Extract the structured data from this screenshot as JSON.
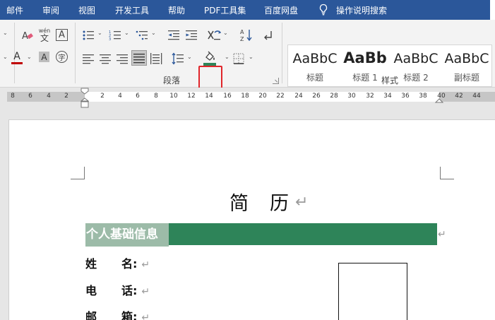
{
  "menu": {
    "tabs": [
      "邮件",
      "审阅",
      "视图",
      "开发工具",
      "帮助",
      "PDF工具集",
      "百度网盘",
      "操作说明搜索"
    ]
  },
  "ribbon": {
    "paragraph_label": "段落",
    "styles_label": "样式",
    "phonetic_glyph": "wén",
    "phonetic_base": "文",
    "box_char_glyph": "A",
    "shading_letter": "A",
    "enclose_char": "字",
    "font_color_letter": "A",
    "styles": [
      {
        "sample": "AaBbC",
        "name": "标题"
      },
      {
        "sample": "AaBb",
        "name": "标题 1"
      },
      {
        "sample": "AaBbC",
        "name": "标题 2"
      },
      {
        "sample": "AaBbC",
        "name": "副标题"
      }
    ]
  },
  "ruler": {
    "left_numbers": [
      "8",
      "6",
      "4",
      "2"
    ],
    "right_numbers": [
      "2",
      "4",
      "6",
      "8",
      "10",
      "12",
      "14",
      "16",
      "18",
      "20",
      "22",
      "24",
      "26",
      "28",
      "30",
      "32",
      "34",
      "36",
      "38",
      "40",
      "42",
      "44"
    ]
  },
  "document": {
    "title_part1": "简",
    "title_part2": "历",
    "paragraph_mark": "↵",
    "section_heading": "个人基础信息",
    "fields": [
      {
        "label_a": "姓",
        "label_b": "名:"
      },
      {
        "label_a": "电",
        "label_b": "话:"
      },
      {
        "label_a": "邮",
        "label_b": "箱:"
      }
    ]
  },
  "colors": {
    "menubar": "#2b579a",
    "section_bar": "#2e8459",
    "section_label_bg": "#9cbba8",
    "highlight_box": "#e0252a",
    "font_color_underline": "#c00000",
    "shading_underline": "#2e8459"
  }
}
